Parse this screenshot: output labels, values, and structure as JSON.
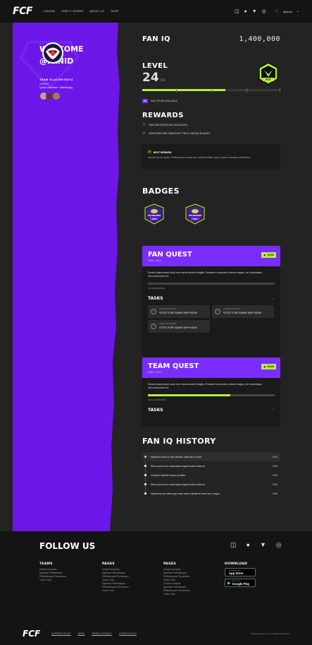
{
  "nav": {
    "logo": "FCF",
    "links": [
      "LEAGUE",
      "HOW IT WORKS",
      "ABOUT US",
      "SHOP"
    ],
    "icons": [
      "twitch-icon",
      "facebook-icon",
      "twitter-icon",
      "instagram-icon"
    ],
    "user": "@fanid"
  },
  "profile": {
    "welcome_line1": "WELCOME",
    "welcome_line2": "@FANID",
    "team_name": "TEAM GLACIER BOYZ",
    "owners_label": "OWNERS",
    "owners": "Quavo, Richard + Swerbrying"
  },
  "fan_iq": {
    "title": "FAN IQ",
    "value": "1,400,000"
  },
  "level": {
    "title": "LEVEL",
    "current": "24",
    "max": "/50",
    "badge_label": "FCF",
    "progress": 0.6,
    "multiplier_chip": "2X",
    "multiplier_text": "MULTIPLIER AVAILABLE"
  },
  "rewards": {
    "title": "REWARDS",
    "items": [
      "NEW BACKGROUND UNLOCKED",
      "AWESOME 3RD OWN EGET PRIVS VARIUS BLANDIT"
    ],
    "next_label": "NEXT REWARD",
    "next_text": "Aenean eu leo quam. Pellentesque ornare sem lacinia Nullam ipsum quam venenatis vestibulum."
  },
  "badges": {
    "title": "BADGES",
    "items": [
      {
        "label": "FOUNDERS",
        "sub": "FCF"
      },
      {
        "label": "FOUNDERS",
        "sub": "FCF"
      }
    ]
  },
  "fan_quest": {
    "title": "FAN QUEST",
    "dates": "01/04 - 01/10",
    "points": "15,000",
    "description": "Donec ullamcorper nulla non metus auctor fringilla. Praesent commodo cursus magna, vel scelerisque nisl consectetur et.",
    "progress": 0.0,
    "completed": "0% COMPLETED",
    "tasks_label": "TASKS",
    "tasks": [
      {
        "small": "GAME PARTIOPANT",
        "big": "VOTE FOR GAME MVP NOW"
      },
      {
        "small": "GAME PARTIOPANT",
        "big": "VOTE FOR GAME MVP NOW"
      },
      {
        "small": "GAME PARTIOPANT",
        "big": "VOTE FOR GAME MVP NOW"
      }
    ]
  },
  "team_quest": {
    "title": "TEAM QUEST",
    "dates": "01/04 - 01/10",
    "points": "15,000",
    "description": "Donec ullamcorper nulla non metus auctor fringilla. Praesent commodo cursus magna, vel scelerisque nisl consectetur et.",
    "progress": 0.65,
    "completed": "65% COMPLETED",
    "tasks_label": "TASKS"
  },
  "history": {
    "title": "FAN IQ HISTORY",
    "items": [
      {
        "text": "Nullam id dolor id nibh ultricies vehicula ut id elit",
        "pts": "+200"
      },
      {
        "text": "Etiam porta sem malesuada magna mollis euismod",
        "pts": "+200"
      },
      {
        "text": "Curabitur blandit tempus porttitor",
        "pts": "+200"
      },
      {
        "text": "Etiam porta sem malesuada magna mollis euismod",
        "pts": "+200"
      },
      {
        "text": "Maecenas sed diam eget risus varius blandit sit amet non magna",
        "pts": "+200"
      }
    ]
  },
  "footer": {
    "follow": "FOLLOW US",
    "teams": {
      "title": "TEAMS",
      "links": [
        "Ornare Inceptos",
        "Egestas Pellentesque",
        "Pellentesque Fermentum",
        "Tortor Cras"
      ]
    },
    "pages1": {
      "title": "PAGES",
      "links": [
        "Ornare Inceptos",
        "Egestas Pellentesque",
        "Pellentesque Fermentum",
        "Tortor Cras",
        "Egestas Pellentesque",
        "Pellentesque Fermentum",
        "Tortor Cras"
      ]
    },
    "pages2": {
      "title": "PAGES",
      "links": [
        "Ornare Inceptos",
        "Egestas Pellentesque",
        "Pellentesque Fermentum",
        "Tortor Cras",
        "Ornare Inceptos",
        "Egestas Pellentesque",
        "Pellentesque Fermentum",
        "Tortor Cras"
      ]
    },
    "download": {
      "title": "DOWNLOAD",
      "app_store_top": "Download on the",
      "app_store": "App Store",
      "google_top": "GET IT ON",
      "google": "Google Play"
    },
    "bottom_logo": "FCF",
    "bottom_links": [
      "SUPPORT TICKET",
      "NEWS",
      "TERMS & PRIVACY",
      "COOKIE POLICY"
    ],
    "copyright": "2020 Fanchise LLC | All Rights Reserved"
  },
  "colors": {
    "purple": "#7b2cff",
    "lime": "#b6f03c",
    "dark": "#232323"
  }
}
